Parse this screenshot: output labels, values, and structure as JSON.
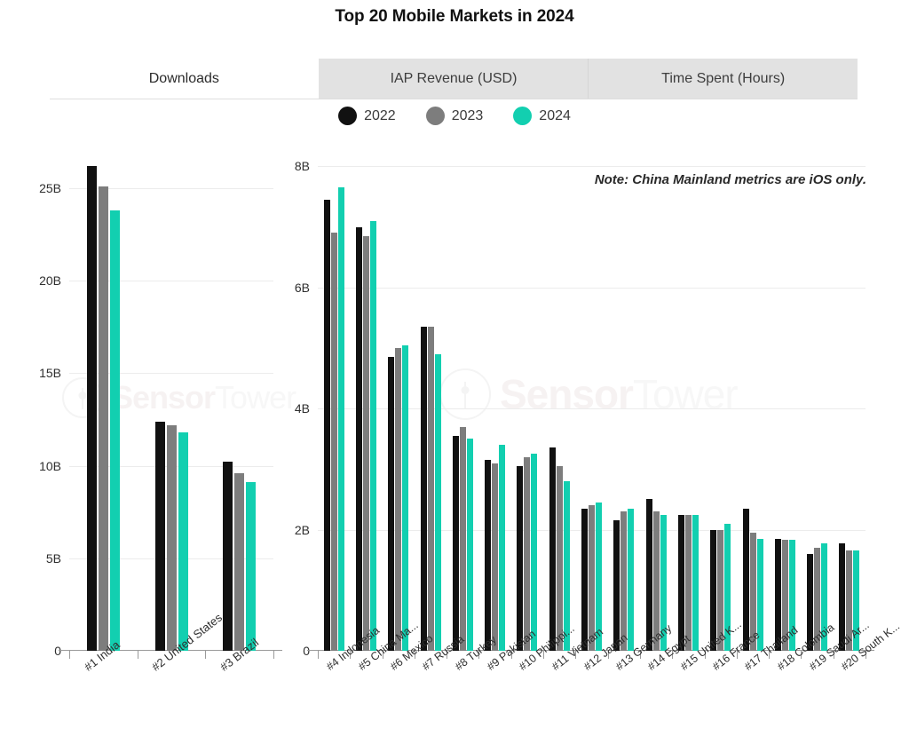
{
  "header": {
    "title": "Top 20 Mobile Markets in 2024"
  },
  "tabs": [
    {
      "label": "Downloads",
      "active": true
    },
    {
      "label": "IAP Revenue (USD)",
      "active": false
    },
    {
      "label": "Time Spent (Hours)",
      "active": false
    }
  ],
  "legend": [
    {
      "label": "2022",
      "color": "#111111"
    },
    {
      "label": "2023",
      "color": "#7d7d7d"
    },
    {
      "label": "2024",
      "color": "#12cfb0"
    }
  ],
  "note": "Note: China Mainland metrics are iOS only.",
  "watermark": {
    "brand_bold": "Sensor",
    "brand_light": "Tower"
  },
  "colors": {
    "y2022": "#111111",
    "y2023": "#7d7d7d",
    "y2024": "#12cfb0",
    "tab_active_bg": "#ffffff",
    "tab_inactive_bg": "#e2e2e2",
    "gridline": "#ececec",
    "axis": "#9a9a9a"
  },
  "chart_data": [
    {
      "id": "left",
      "type": "bar",
      "title": "Top 20 Mobile Markets in 2024",
      "subtitle": "Downloads",
      "xlabel": "",
      "ylabel": "",
      "ylim": [
        0,
        27.5
      ],
      "yticks": [
        0,
        5,
        10,
        15,
        20,
        25
      ],
      "ytick_labels": [
        "0",
        "5B",
        "10B",
        "15B",
        "20B",
        "25B"
      ],
      "grid": true,
      "legend_position": "top-center",
      "categories": [
        "#1 India",
        "#2 United States",
        "#3 Brazil"
      ],
      "series": [
        {
          "name": "2022",
          "color": "#111111",
          "values": [
            26.2,
            12.4,
            10.2
          ]
        },
        {
          "name": "2023",
          "color": "#7d7d7d",
          "values": [
            25.1,
            12.2,
            9.6
          ]
        },
        {
          "name": "2024",
          "color": "#12cfb0",
          "values": [
            23.8,
            11.8,
            9.1
          ]
        }
      ]
    },
    {
      "id": "right",
      "type": "bar",
      "title": "",
      "subtitle": "Downloads",
      "xlabel": "",
      "ylabel": "",
      "ylim": [
        0,
        8.4
      ],
      "yticks": [
        0,
        2,
        4,
        6,
        8
      ],
      "ytick_labels": [
        "0",
        "2B",
        "4B",
        "6B",
        "8B"
      ],
      "grid": true,
      "legend_position": "top-center",
      "annotation": "Note: China Mainland metrics are iOS only.",
      "categories": [
        "#4 Indonesia",
        "#5 China Ma...",
        "#6 Mexico",
        "#7 Russia",
        "#8 Turkey",
        "#9 Pakistan",
        "#10 Philippi...",
        "#11 Vietnam",
        "#12 Japan",
        "#13 Germany",
        "#14 Egypt",
        "#15 United K...",
        "#16 France",
        "#17 Thailand",
        "#18 Colombia",
        "#19 Saudi Ar...",
        "#20 South K..."
      ],
      "series": [
        {
          "name": "2022",
          "color": "#111111",
          "values": [
            7.45,
            7.0,
            4.85,
            5.35,
            3.55,
            3.15,
            3.05,
            3.35,
            2.35,
            2.15,
            2.5,
            2.25,
            2.0,
            2.35,
            1.85,
            1.6,
            1.78
          ]
        },
        {
          "name": "2023",
          "color": "#7d7d7d",
          "values": [
            6.9,
            6.85,
            5.0,
            5.35,
            3.7,
            3.1,
            3.2,
            3.05,
            2.4,
            2.3,
            2.3,
            2.25,
            2.0,
            1.95,
            1.83,
            1.7,
            1.65
          ]
        },
        {
          "name": "2024",
          "color": "#12cfb0",
          "values": [
            7.65,
            7.1,
            5.05,
            4.9,
            3.5,
            3.4,
            3.25,
            2.8,
            2.45,
            2.35,
            2.25,
            2.25,
            2.1,
            1.85,
            1.83,
            1.78,
            1.65
          ]
        }
      ]
    }
  ]
}
